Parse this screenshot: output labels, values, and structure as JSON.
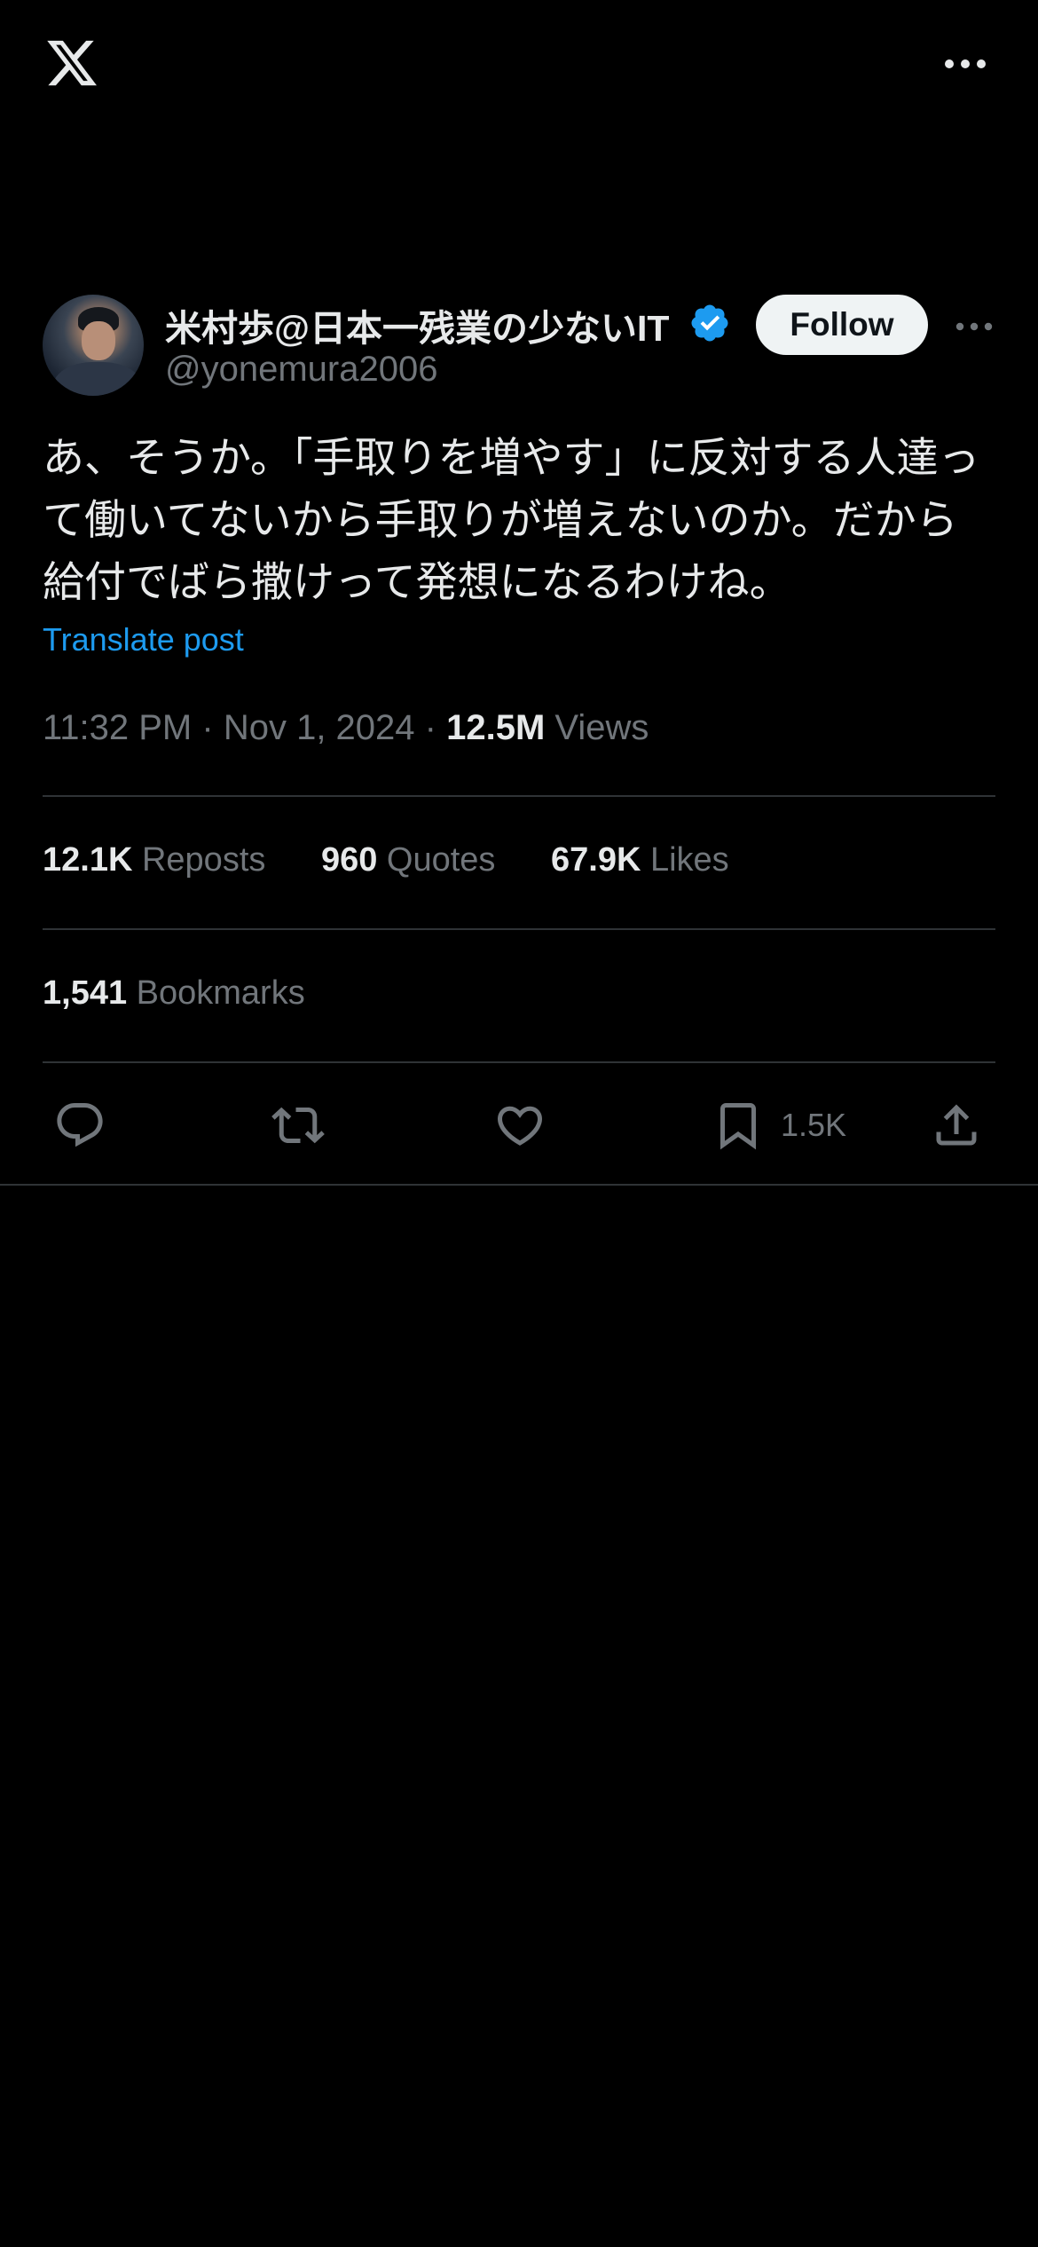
{
  "icons": {
    "logo": "x-logo",
    "menu": "more-horizontal-icon",
    "verified": "verified-badge-icon",
    "reply": "reply-icon",
    "repost": "repost-icon",
    "like": "heart-icon",
    "bookmark": "bookmark-icon",
    "share": "share-icon"
  },
  "colors": {
    "background": "#000000",
    "text": "#e7e9ea",
    "secondary_text": "#71767b",
    "accent": "#1d9bf0",
    "divider": "#2f3336",
    "follow_button_bg": "#eff3f4"
  },
  "post": {
    "author": {
      "display_name": "米村歩@日本一残業の少ないIT",
      "handle": "@yonemura2006",
      "verified": true
    },
    "follow_label": "Follow",
    "text": "あ、そうか。「手取りを増やす」に反対する人達って働いてないから手取りが増えないのか。だから給付でばら撒けって発想になるわけね。",
    "translate_label": "Translate post",
    "time": "11:32 PM",
    "date": "Nov 1, 2024",
    "separator": "·",
    "views_count": "12.5M",
    "views_label": "Views"
  },
  "stats": {
    "reposts": {
      "count": "12.1K",
      "label": "Reposts"
    },
    "quotes": {
      "count": "960",
      "label": "Quotes"
    },
    "likes": {
      "count": "67.9K",
      "label": "Likes"
    },
    "bookmarks": {
      "count": "1,541",
      "label": "Bookmarks"
    }
  },
  "actions": {
    "bookmark_count": "1.5K"
  }
}
